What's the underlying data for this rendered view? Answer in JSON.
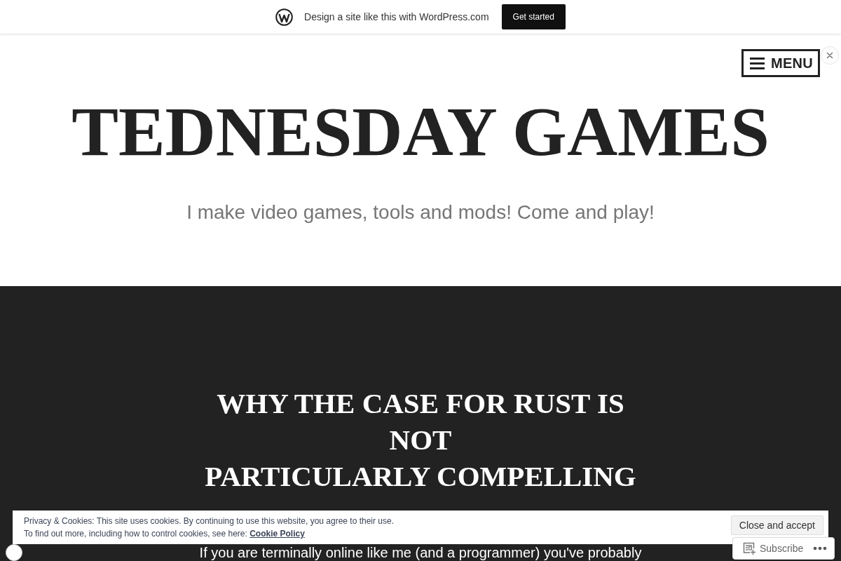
{
  "promo_bar": {
    "text": "Design a site like this with WordPress.com",
    "button": "Get started"
  },
  "header": {
    "menu_button": "MENU",
    "site_title": "TEDNESDAY GAMES",
    "tagline": "I make video games, tools and mods! Come and play!"
  },
  "post": {
    "title_lines": [
      "WHY THE CASE FOR RUST IS",
      "NOT",
      "PARTICULARLY COMPELLING"
    ],
    "excerpt": "If you are terminally online like me (and a programmer) you've probably"
  },
  "cookie_banner": {
    "text_line_1": "Privacy & Cookies: This site uses cookies. By continuing to use this website, you agree to their use.",
    "text_line_2": "To find out more, including how to control cookies, see here:",
    "link": "Cookie Policy",
    "button": "Close and accept"
  },
  "subscribe_widget": {
    "button": "Subscribe"
  }
}
